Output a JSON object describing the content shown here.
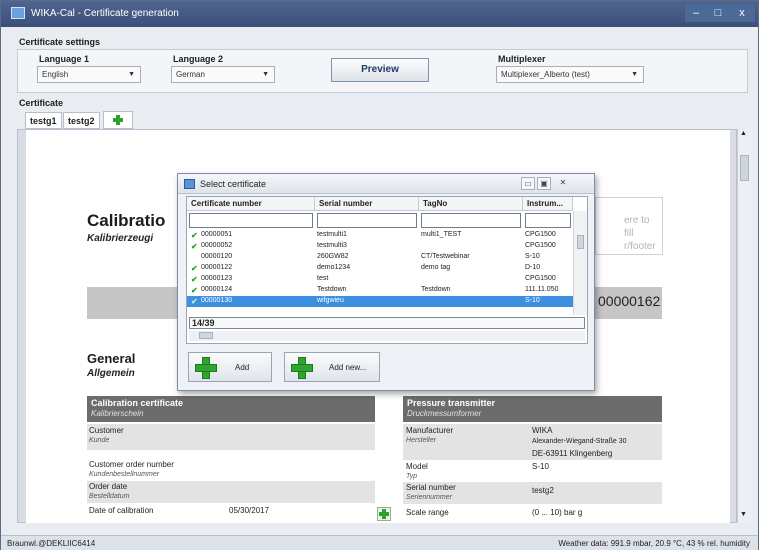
{
  "window": {
    "title": "WIKA-Cal - Certificate generation",
    "min": "–",
    "max": "□",
    "close": "x"
  },
  "settings": {
    "section_label": "Certificate settings",
    "language1_label": "Language 1",
    "language1_value": "English",
    "language2_label": "Language 2",
    "language2_value": "German",
    "preview_label": "Preview",
    "multiplexer_label": "Multiplexer",
    "multiplexer_value": "Multiplexer_Alberto (test)"
  },
  "certificate": {
    "section_label": "Certificate",
    "tabs": [
      {
        "label": "testg1"
      },
      {
        "label": "testg2"
      }
    ]
  },
  "document": {
    "title": "Calibratio",
    "subtitle": "Kalibrierzeugi",
    "footer_hint_line1": "ere to fill",
    "footer_hint_line2": "r/footer",
    "cert_number": "00000162",
    "general_title": "General",
    "general_subtitle": "Allgemein",
    "left_header": "Calibration certificate",
    "left_header_sub": "Kalibrierschein",
    "customer": "Customer",
    "customer_sub": "Kunde",
    "order_number": "Customer order number",
    "order_number_sub": "Kundenbestellnummer",
    "order_date": "Order date",
    "order_date_sub": "Bestelldatum",
    "date_of_cal": "Date of calibration",
    "date_of_cal_value": "05/30/2017",
    "right_header": "Pressure transmitter",
    "right_header_sub": "Druckmessumformer",
    "manufacturer": "Manufacturer",
    "manufacturer_sub": "Hersteller",
    "manufacturer_value": "WIKA",
    "address1": "Alexander-Wiegand-Straße 30",
    "address2": "DE-63911 Klingenberg",
    "model": "Model",
    "model_sub": "Typ",
    "model_value": "S-10",
    "serial": "Serial number",
    "serial_sub": "Seriennummer",
    "serial_value": "testg2",
    "scale": "Scale range",
    "scale_value": "(0 ... 10) bar g"
  },
  "dialog": {
    "title": "Select certificate",
    "ctl_min": "▭",
    "ctl_max": "▣",
    "ctl_close": "✕",
    "columns": [
      "Certificate number",
      "Serial number",
      "TagNo",
      "Instrum..."
    ],
    "rows": [
      {
        "check": "✔",
        "cert": "00000051",
        "serial": "testmulti1",
        "tag": "multi1_TEST",
        "instr": "CPG1500"
      },
      {
        "check": "✔",
        "cert": "00000052",
        "serial": "testmulti3",
        "tag": "",
        "instr": "CPG1500"
      },
      {
        "check": "",
        "cert": "00000120",
        "serial": "260GW82",
        "tag": "CT/Testwebinar",
        "instr": "S-10"
      },
      {
        "check": "✔",
        "cert": "00000122",
        "serial": "demo1234",
        "tag": "demo tag",
        "instr": "D-10"
      },
      {
        "check": "✔",
        "cert": "00000123",
        "serial": "test",
        "tag": "",
        "instr": "CPG1500"
      },
      {
        "check": "✔",
        "cert": "00000124",
        "serial": "Testdown",
        "tag": "Testdown",
        "instr": "111.11.050"
      },
      {
        "check": "✔",
        "cert": "00000130",
        "serial": "wifgwieu",
        "tag": "",
        "instr": "S-10"
      }
    ],
    "counter": "14/39",
    "add_label": "Add",
    "add_new_label": "Add new..."
  },
  "status": {
    "user": "Braunwl.@DEKLIIC6414",
    "weather": "Weather data: 991.9 mbar, 20.9 °C, 43 % rel. humidity"
  }
}
